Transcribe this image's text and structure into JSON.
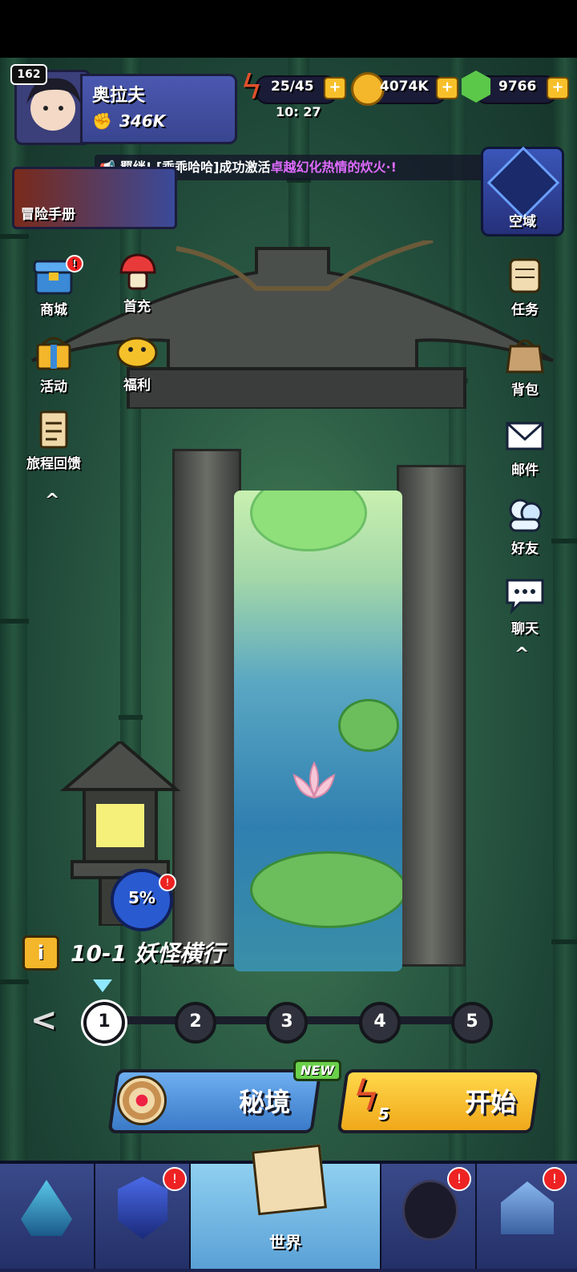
{
  "player": {
    "level": "162",
    "name": "奥拉夫",
    "power": "346K"
  },
  "resources": {
    "energy": "25/45",
    "energy_timer": "10: 27",
    "gold": "4074K",
    "gems": "9766",
    "plus": "+"
  },
  "ticker": {
    "prefix": "羁绊! [乖乖哈哈]成功激活",
    "highlight": "卓越幻化热情的炊火·!"
  },
  "adventure_book": {
    "label": "冒险手册"
  },
  "sky_domain": {
    "label": "空域"
  },
  "left_menu": [
    {
      "label": "商城",
      "icon": "chest-icon",
      "badge": "!"
    },
    {
      "label": "首充",
      "icon": "mushroom-icon"
    },
    {
      "label": "活动",
      "icon": "gift-icon"
    },
    {
      "label": "福利",
      "icon": "pig-icon"
    },
    {
      "label": "旅程回馈",
      "icon": "clipboard-icon"
    }
  ],
  "right_menu": [
    {
      "label": "任务",
      "icon": "scroll-icon"
    },
    {
      "label": "背包",
      "icon": "bag-icon"
    },
    {
      "label": "邮件",
      "icon": "mail-icon"
    },
    {
      "label": "好友",
      "icon": "friends-icon"
    },
    {
      "label": "聊天",
      "icon": "chat-icon"
    }
  ],
  "chevron": "^",
  "progress_badge": {
    "value": "5%",
    "badge": "!"
  },
  "stage": {
    "info_icon": "i",
    "title": "10-1 妖怪横行",
    "steps": [
      "1",
      "2",
      "3",
      "4",
      "5"
    ],
    "current_step": 1
  },
  "nav_left": "<",
  "buttons": {
    "secret_realm": "秘境",
    "new_tag": "NEW",
    "start": "开始",
    "start_cost": "5"
  },
  "bottom_tabs": [
    {
      "name": "hero",
      "badge": ""
    },
    {
      "name": "upgrade",
      "badge": "!"
    },
    {
      "name": "world",
      "label": "世界"
    },
    {
      "name": "companion",
      "badge": "!"
    },
    {
      "name": "base",
      "badge": "!"
    }
  ],
  "colors": {
    "energy": "#e0502a",
    "gold": "#f4b62a",
    "gem": "#5cc84a",
    "start_button": "#f6c02e",
    "realm_button": "#4a8ed6"
  }
}
